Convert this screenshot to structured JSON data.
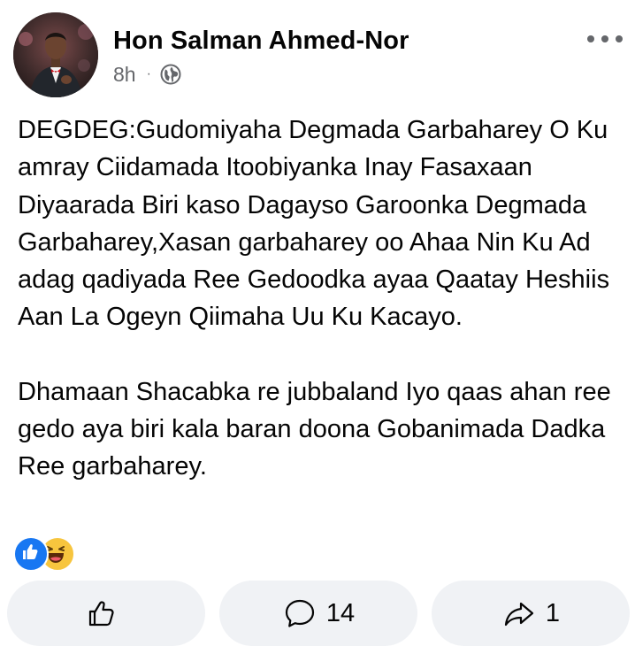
{
  "post": {
    "author": "Hon Salman Ahmed-Nor",
    "time": "8h",
    "separator": "·",
    "audience_icon": "globe-icon",
    "body": [
      "DEGDEG:Gudomiyaha Degmada Garbaharey O Ku amray Ciidamada Itoobiyanka Inay Fasaxaan Diyaarada Biri kaso Dagayso Garoonka Degmada Garbaharey,Xasan garbaharey oo Ahaa Nin Ku Ad adag qadiyada Ree Gedoodka ayaa Qaatay Heshiis Aan La Ogeyn Qiimaha Uu Ku Kacayo.",
      "Dhamaan Shacabka re jubbaland Iyo qaas ahan ree gedo aya biri kala baran doona Gobanimada Dadka Ree garbaharey."
    ],
    "reactions": [
      "like-icon",
      "haha-icon"
    ]
  },
  "actions": {
    "like": {
      "icon": "thumbs-up-icon",
      "label": ""
    },
    "comment": {
      "icon": "comment-bubble-icon",
      "count": "14"
    },
    "share": {
      "icon": "share-arrow-icon",
      "count": "1"
    }
  },
  "colors": {
    "text": "#050505",
    "secondary": "#65676b",
    "button_bg": "#f0f2f5",
    "like_blue": "#1877f2",
    "haha_yellow": "#f7c53e"
  }
}
